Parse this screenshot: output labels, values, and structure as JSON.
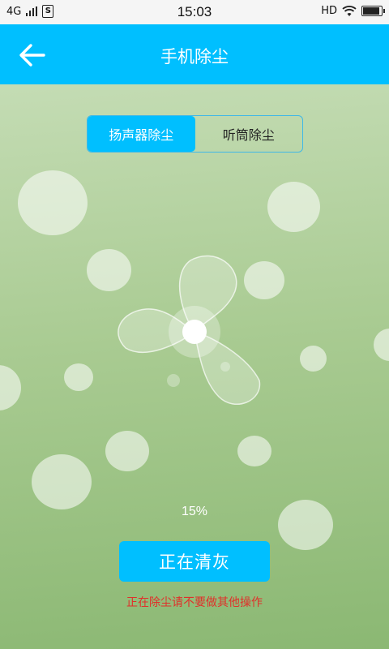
{
  "status_bar": {
    "network": "4G",
    "time": "15:03",
    "hd": "HD",
    "sim_label": "S",
    "battery_level": 0.9
  },
  "header": {
    "title": "手机除尘",
    "back_icon": "arrow-left-icon"
  },
  "tabs": [
    {
      "label": "扬声器除尘",
      "active": true
    },
    {
      "label": "听筒除尘",
      "active": false
    }
  ],
  "progress": {
    "value": 0.15,
    "text": "15%"
  },
  "action_button": {
    "label": "正在清灰"
  },
  "warning": {
    "text": "正在除尘请不要做其他操作"
  },
  "colors": {
    "accent": "#00bfff",
    "warning": "#e0302a",
    "background_top": "#c4dcb4",
    "background_bottom": "#8bb873"
  }
}
